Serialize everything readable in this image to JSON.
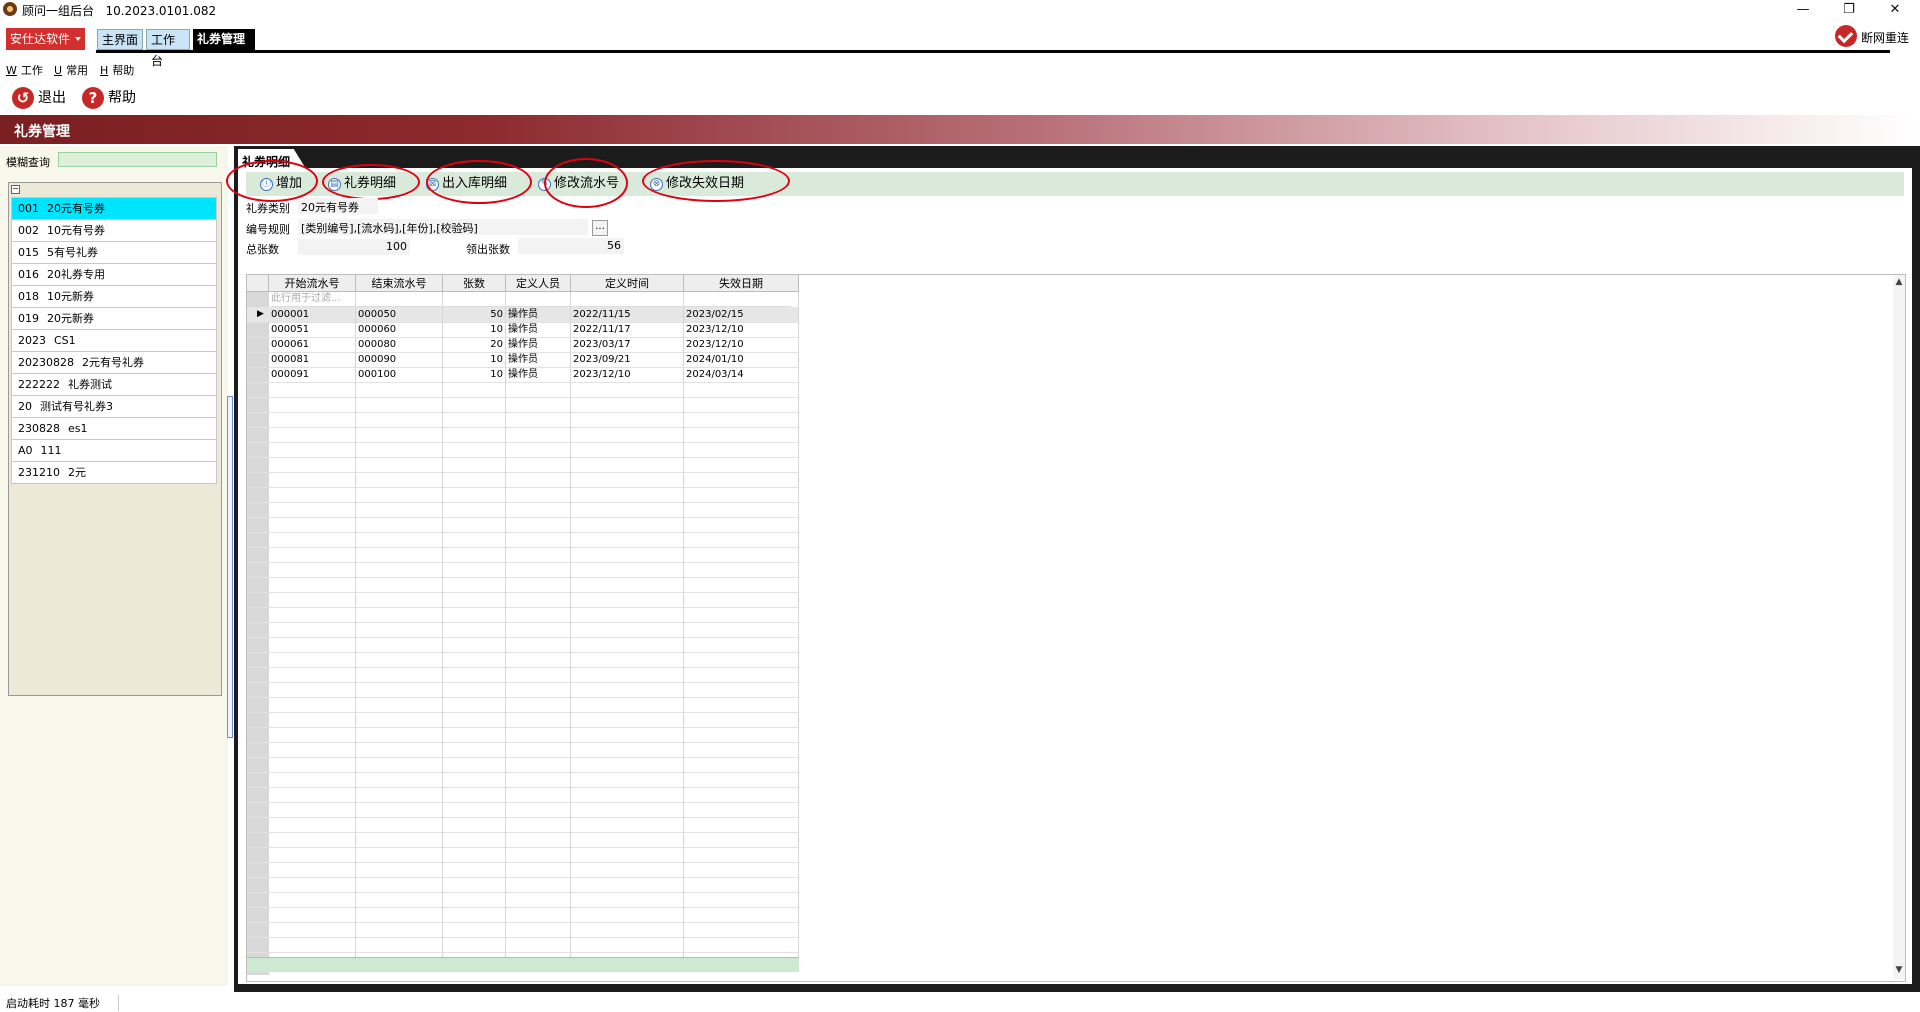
{
  "titlebar": {
    "title": "顾问一组后台",
    "version": "10.2023.0101.082",
    "minimize": "—",
    "restore": "❐",
    "close": "✕"
  },
  "top": {
    "company": "安仕达软件",
    "tabs": [
      {
        "label": "主界面"
      },
      {
        "label": "工作台"
      },
      {
        "label": "礼券管理"
      }
    ],
    "reconnect": "断网重连"
  },
  "menubar": [
    {
      "key": "W",
      "label": "工作"
    },
    {
      "key": "U",
      "label": "常用"
    },
    {
      "key": "H",
      "label": "帮助"
    }
  ],
  "toolbar": {
    "exit": "退出",
    "help": "帮助"
  },
  "section": {
    "title": "礼券管理"
  },
  "left": {
    "search_label": "模糊查询",
    "search_value": "",
    "tree_toggle": "−",
    "items": [
      {
        "code": "001",
        "name": "20元有号券"
      },
      {
        "code": "002",
        "name": "10元有号券"
      },
      {
        "code": "015",
        "name": "5有号礼券"
      },
      {
        "code": "016",
        "name": "20礼券专用"
      },
      {
        "code": "018",
        "name": "10元新券"
      },
      {
        "code": "019",
        "name": "20元新券"
      },
      {
        "code": "2023",
        "name": "CS1"
      },
      {
        "code": "20230828",
        "name": "2元有号礼券"
      },
      {
        "code": "222222",
        "name": "礼券测试"
      },
      {
        "code": "20",
        "name": "测试有号礼券3"
      },
      {
        "code": "230828",
        "name": "es1"
      },
      {
        "code": "A0",
        "name": "111"
      },
      {
        "code": "231210",
        "name": "2元"
      }
    ]
  },
  "detail": {
    "tab_label": "礼券明细",
    "actions": [
      {
        "label": "增加",
        "icon": "ⓘ"
      },
      {
        "label": "礼券明细",
        "icon": "▤"
      },
      {
        "label": "出入库明细",
        "icon": "⊠"
      },
      {
        "label": "修改流水号",
        "icon": "✎"
      },
      {
        "label": "修改失效日期",
        "icon": "⊗"
      }
    ],
    "type_label": "礼券类别",
    "type_value": "20元有号券",
    "rule_label": "编号规则",
    "rule_value": "[类别编号],[流水码],[年份],[校验码]",
    "ellipsis": "...",
    "total_label": "总张数",
    "total_value": "100",
    "issued_label": "领出张数",
    "issued_value": "56"
  },
  "grid": {
    "columns": [
      "开始流水号",
      "结束流水号",
      "张数",
      "定义人员",
      "定义时间",
      "失效日期"
    ],
    "filter_hint": "此行用于过滤...",
    "current_row_marker": "▶",
    "rows": [
      [
        "000001",
        "000050",
        "50",
        "操作员",
        "2022/11/15",
        "2023/02/15"
      ],
      [
        "000051",
        "000060",
        "10",
        "操作员",
        "2022/11/17",
        "2023/12/10"
      ],
      [
        "000061",
        "000080",
        "20",
        "操作员",
        "2023/03/17",
        "2023/12/10"
      ],
      [
        "000081",
        "000090",
        "10",
        "操作员",
        "2023/09/21",
        "2024/01/10"
      ],
      [
        "000091",
        "000100",
        "10",
        "操作员",
        "2023/12/10",
        "2024/03/14"
      ]
    ],
    "scroll_up": "▲",
    "scroll_down": "▼"
  },
  "status": {
    "text": "启动耗时 187 毫秒"
  },
  "colors": {
    "brand_red": "#d32f2f",
    "selected_row": "#00e5ff",
    "action_bar": "#d9eadb",
    "annotation_ring": "#e0000f"
  }
}
